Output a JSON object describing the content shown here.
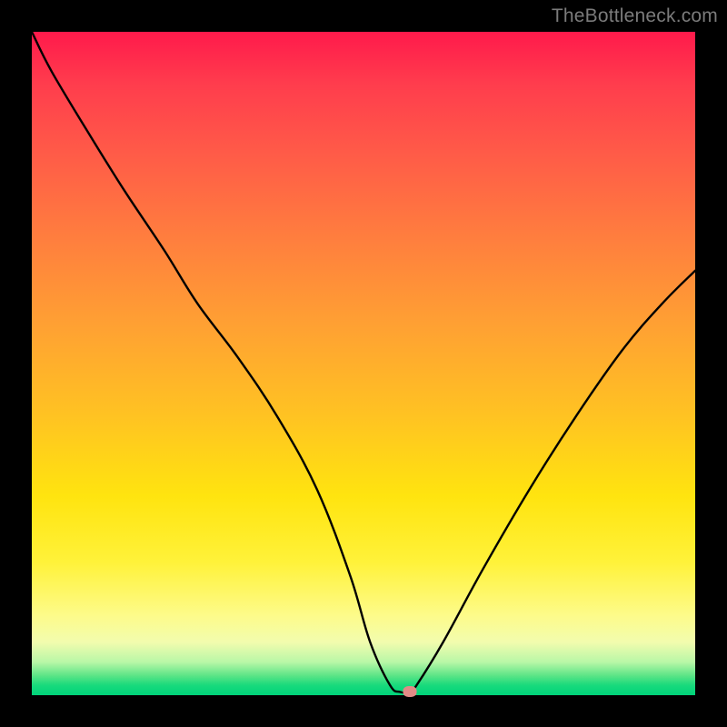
{
  "watermark": "TheBottleneck.com",
  "chart_data": {
    "type": "line",
    "title": "",
    "xlabel": "",
    "ylabel": "",
    "xlim": [
      0,
      100
    ],
    "ylim": [
      0,
      100
    ],
    "x": [
      0,
      3,
      9,
      14,
      20,
      25,
      31,
      37,
      43,
      48,
      51,
      54,
      55.5,
      57,
      58,
      62,
      68,
      75,
      82,
      89,
      95,
      100
    ],
    "values": [
      100,
      94,
      84,
      76,
      67,
      59,
      51,
      42,
      31,
      18,
      8,
      1.5,
      0.5,
      0.5,
      1.5,
      8,
      19,
      31,
      42,
      52,
      59,
      64
    ],
    "marker": {
      "x": 57,
      "y": 0.5
    },
    "grid": false,
    "legend": false
  }
}
